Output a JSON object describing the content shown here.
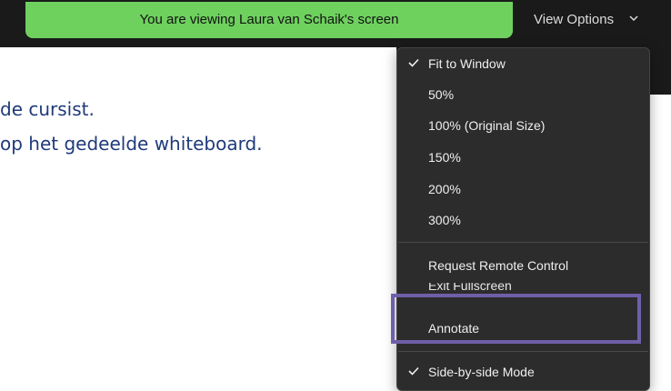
{
  "banner": {
    "text": "You are viewing Laura van Schaik's screen",
    "color": "#6ed15e"
  },
  "view_options": {
    "label": "View Options",
    "icon": "chevron-down-icon"
  },
  "document": {
    "line1": "de cursist.",
    "line2": "op het gedeelde whiteboard."
  },
  "menu": {
    "fit_to_window": "Fit to Window",
    "zoom_50": "50%",
    "zoom_100": "100% (Original Size)",
    "zoom_150": "150%",
    "zoom_200": "200%",
    "zoom_300": "300%",
    "request_remote_control": "Request Remote Control",
    "exit_fullscreen": "Exit Fullscreen",
    "annotate": "Annotate",
    "side_by_side_mode": "Side-by-side Mode",
    "checked_icon": "checkmark-icon"
  },
  "colors": {
    "menu_bg": "#2c2c2c",
    "highlight": "#6f5fa8",
    "doc_text": "#1f3a7a"
  }
}
